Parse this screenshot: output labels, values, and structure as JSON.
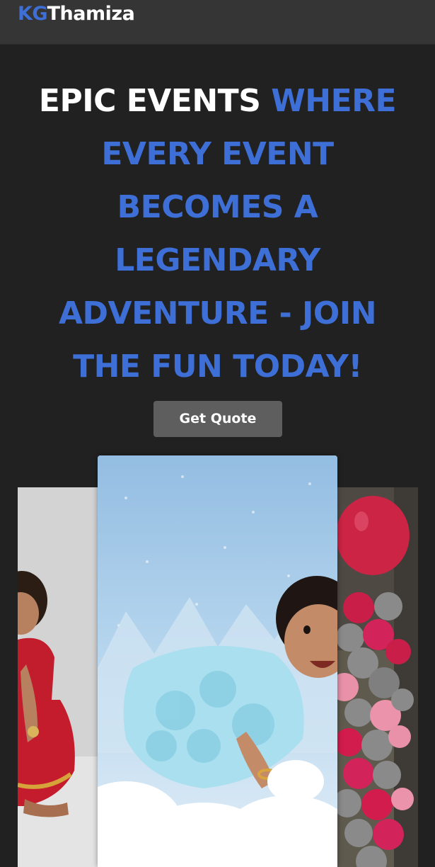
{
  "nav": {
    "logo_prefix": "KG",
    "logo_rest": "Thamiza"
  },
  "hero": {
    "title_white": "EPIC EVENTS",
    "title_blue": "WHERE EVERY EVENT BECOMES A LEGENDARY ADVENTURE - JOIN THE FUN TODAY!",
    "cta_label": "Get Quote"
  },
  "colors": {
    "accent": "#3d6fd6",
    "page_background": "#212121",
    "navbar_background": "#353535",
    "button_background": "#5e5e5e"
  },
  "gallery": {
    "slides": [
      {
        "name": "girl-in-red-dress-photo"
      },
      {
        "name": "baby-in-blue-dress-cloud-photo"
      },
      {
        "name": "balloon-column-photo"
      }
    ]
  }
}
